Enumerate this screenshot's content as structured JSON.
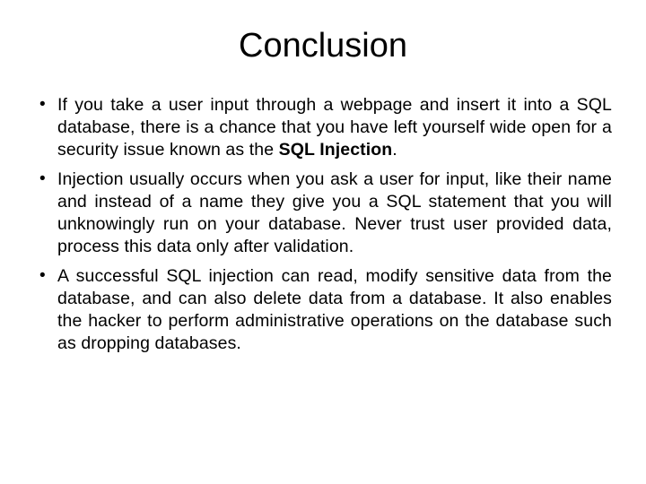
{
  "slide": {
    "title": "Conclusion",
    "bullets": [
      {
        "pre": "If you take a user input through a webpage and insert it into a SQL database, there is a chance that you have left yourself wide open for a security issue known as the ",
        "bold": "SQL Injection",
        "post": "."
      },
      {
        "pre": "Injection usually occurs when you ask a user for input, like their name and instead of a name they give you a SQL statement that you will unknowingly run on your database. Never trust user provided data, process this data only after validation.",
        "bold": "",
        "post": ""
      },
      {
        "pre": "A successful SQL injection can read, modify sensitive data from the database, and can also delete data from a database. It also enables the hacker to perform administrative operations on the database such as dropping databases.",
        "bold": "",
        "post": ""
      }
    ]
  }
}
